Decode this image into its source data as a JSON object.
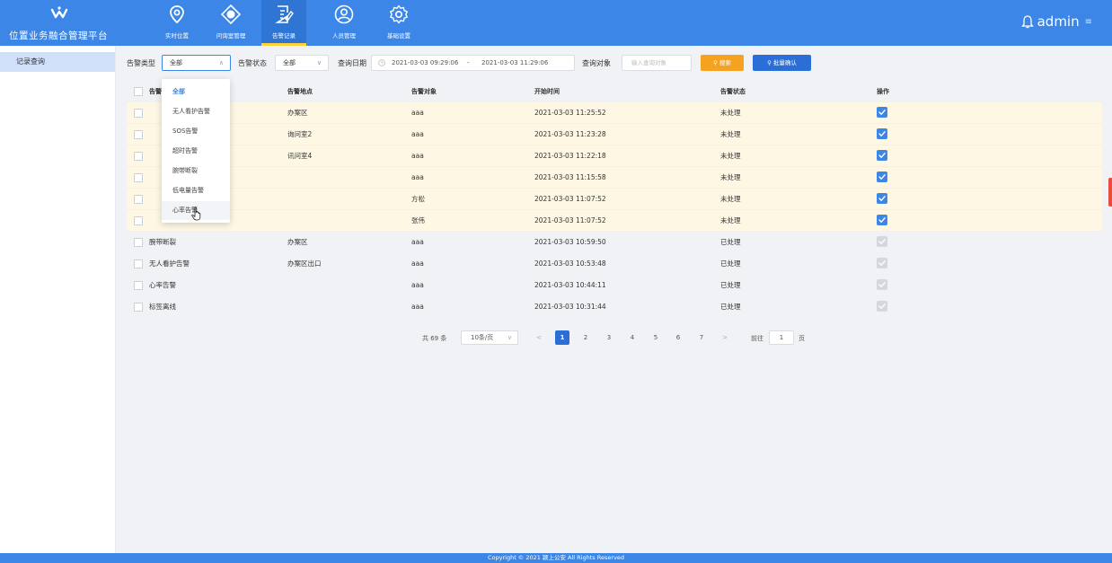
{
  "app": {
    "title": "位置业务融合管理平台"
  },
  "nav": [
    {
      "label": "实时位置",
      "icon": "location-pin-icon",
      "active": false
    },
    {
      "label": "问询室管理",
      "icon": "target-icon",
      "active": false
    },
    {
      "label": "告警记录",
      "icon": "edit-document-icon",
      "active": true
    },
    {
      "label": "人员管理",
      "icon": "user-icon",
      "active": false
    },
    {
      "label": "基础设置",
      "icon": "gear-icon",
      "active": false
    }
  ],
  "user": {
    "name": "admin",
    "icon": "bell-icon"
  },
  "sidebar": {
    "items": [
      {
        "label": "记录查询",
        "active": true
      }
    ]
  },
  "filters": {
    "type_label": "告警类型",
    "type_value": "全部",
    "status_label": "告警状态",
    "status_value": "全部",
    "date_label": "查询日期",
    "date_start": "2021-03-03 09:29:06",
    "date_sep": "-",
    "date_end": "2021-03-03 11:29:06",
    "target_label": "查询对象",
    "target_placeholder": "输入查询对象",
    "search_button": "搜索",
    "batch_button": "批量确认"
  },
  "dropdown": {
    "options": [
      "全部",
      "无人看护告警",
      "SOS告警",
      "超时告警",
      "腕带断裂",
      "低电量告警",
      "心率告警"
    ],
    "selected": "全部",
    "hovered": "心率告警"
  },
  "table": {
    "columns": [
      "告警类型",
      "告警地点",
      "告警对象",
      "开始时间",
      "告警状态",
      "操作"
    ],
    "rows": [
      {
        "type": "",
        "location": "办案区",
        "target": "aaa",
        "start": "2021-03-03 11:25:52",
        "status": "未处理",
        "checked": true
      },
      {
        "type": "",
        "location": "询问室2",
        "target": "aaa",
        "start": "2021-03-03 11:23:28",
        "status": "未处理",
        "checked": true
      },
      {
        "type": "",
        "location": "讯问室4",
        "target": "aaa",
        "start": "2021-03-03 11:22:18",
        "status": "未处理",
        "checked": true
      },
      {
        "type": "",
        "location": "",
        "target": "aaa",
        "start": "2021-03-03 11:15:58",
        "status": "未处理",
        "checked": true
      },
      {
        "type": "",
        "location": "",
        "target": "方松",
        "start": "2021-03-03 11:07:52",
        "status": "未处理",
        "checked": true
      },
      {
        "type": "",
        "location": "",
        "target": "张伟",
        "start": "2021-03-03 11:07:52",
        "status": "未处理",
        "checked": true
      },
      {
        "type": "腕带断裂",
        "location": "办案区",
        "target": "aaa",
        "start": "2021-03-03 10:59:50",
        "status": "已处理",
        "checked": false
      },
      {
        "type": "无人看护告警",
        "location": "办案区出口",
        "target": "aaa",
        "start": "2021-03-03 10:53:48",
        "status": "已处理",
        "checked": false
      },
      {
        "type": "心率告警",
        "location": "",
        "target": "aaa",
        "start": "2021-03-03 10:44:11",
        "status": "已处理",
        "checked": false
      },
      {
        "type": "标签离线",
        "location": "",
        "target": "aaa",
        "start": "2021-03-03 10:31:44",
        "status": "已处理",
        "checked": false
      }
    ]
  },
  "pagination": {
    "total": "共 69 条",
    "page_size": "10条/页",
    "pages": [
      "1",
      "2",
      "3",
      "4",
      "5",
      "6",
      "7"
    ],
    "current": "1",
    "prev": "<",
    "next": ">",
    "goto_prefix": "前往",
    "goto_value": "1",
    "goto_suffix": "页"
  },
  "footer": {
    "text": "Copyright © 2021 颍上公安 All Rights Reserved"
  },
  "colors": {
    "primary": "#3b86e6",
    "search": "#f4a21f",
    "batch": "#2b6fd6",
    "alert_row": "#fdf7e4"
  }
}
